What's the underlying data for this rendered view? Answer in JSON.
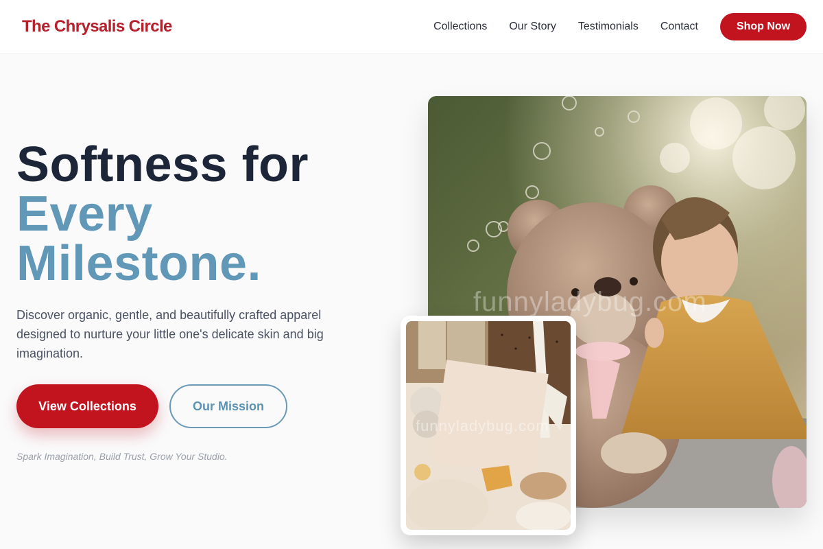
{
  "brand": {
    "name": "The Chrysalis Circle"
  },
  "nav": {
    "links": [
      "Collections",
      "Our Story",
      "Testimonials",
      "Contact"
    ],
    "cta_label": "Shop Now"
  },
  "hero": {
    "title_line1": "Softness for",
    "title_accent_line1": "Every",
    "title_accent_line2": "Milestone.",
    "subtitle": "Discover organic, gentle, and beautifully crafted apparel designed to nurture your little one's delicate skin and big imagination.",
    "primary_button": "View Collections",
    "secondary_button": "Our Mission",
    "tagline": "Spark Imagination, Build Trust, Grow Your Studio."
  },
  "images": {
    "main_photo": "baby-with-teddy-bear-photo",
    "secondary_photo": "baby-accessories-flatlay-photo",
    "watermark_text": "funnyladybug.com"
  },
  "colors": {
    "brand_red": "#c2141f",
    "accent_blue": "#6198b8",
    "heading_dark": "#1c2638"
  }
}
